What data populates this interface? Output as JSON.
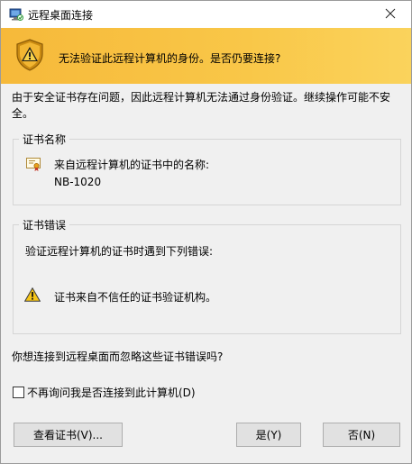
{
  "window": {
    "title": "远程桌面连接",
    "icon": "remote-desktop-icon",
    "close_icon": "close-icon"
  },
  "banner": {
    "icon": "warning-shield-icon",
    "text": "无法验证此远程计算机的身份。是否仍要连接?"
  },
  "intro": "由于安全证书存在问题，因此远程计算机无法通过身份验证。继续操作可能不安全。",
  "cert_name_group": {
    "title": "证书名称",
    "icon": "certificate-icon",
    "label": "来自远程计算机的证书中的名称:",
    "value": "NB-1020"
  },
  "cert_error_group": {
    "title": "证书错误",
    "intro": "验证远程计算机的证书时遇到下列错误:",
    "errors": [
      {
        "icon": "warning-icon",
        "text": "证书来自不信任的证书验证机构。"
      }
    ]
  },
  "question": "你想连接到远程桌面而忽略这些证书错误吗?",
  "checkbox": {
    "label": "不再询问我是否连接到此计算机(D)",
    "checked": false
  },
  "buttons": {
    "view_cert": "查看证书(V)...",
    "yes": "是(Y)",
    "no": "否(N)"
  },
  "colors": {
    "banner_start": "#f6b93a",
    "banner_end": "#fad35c",
    "window_bg": "#f0f0f0"
  }
}
